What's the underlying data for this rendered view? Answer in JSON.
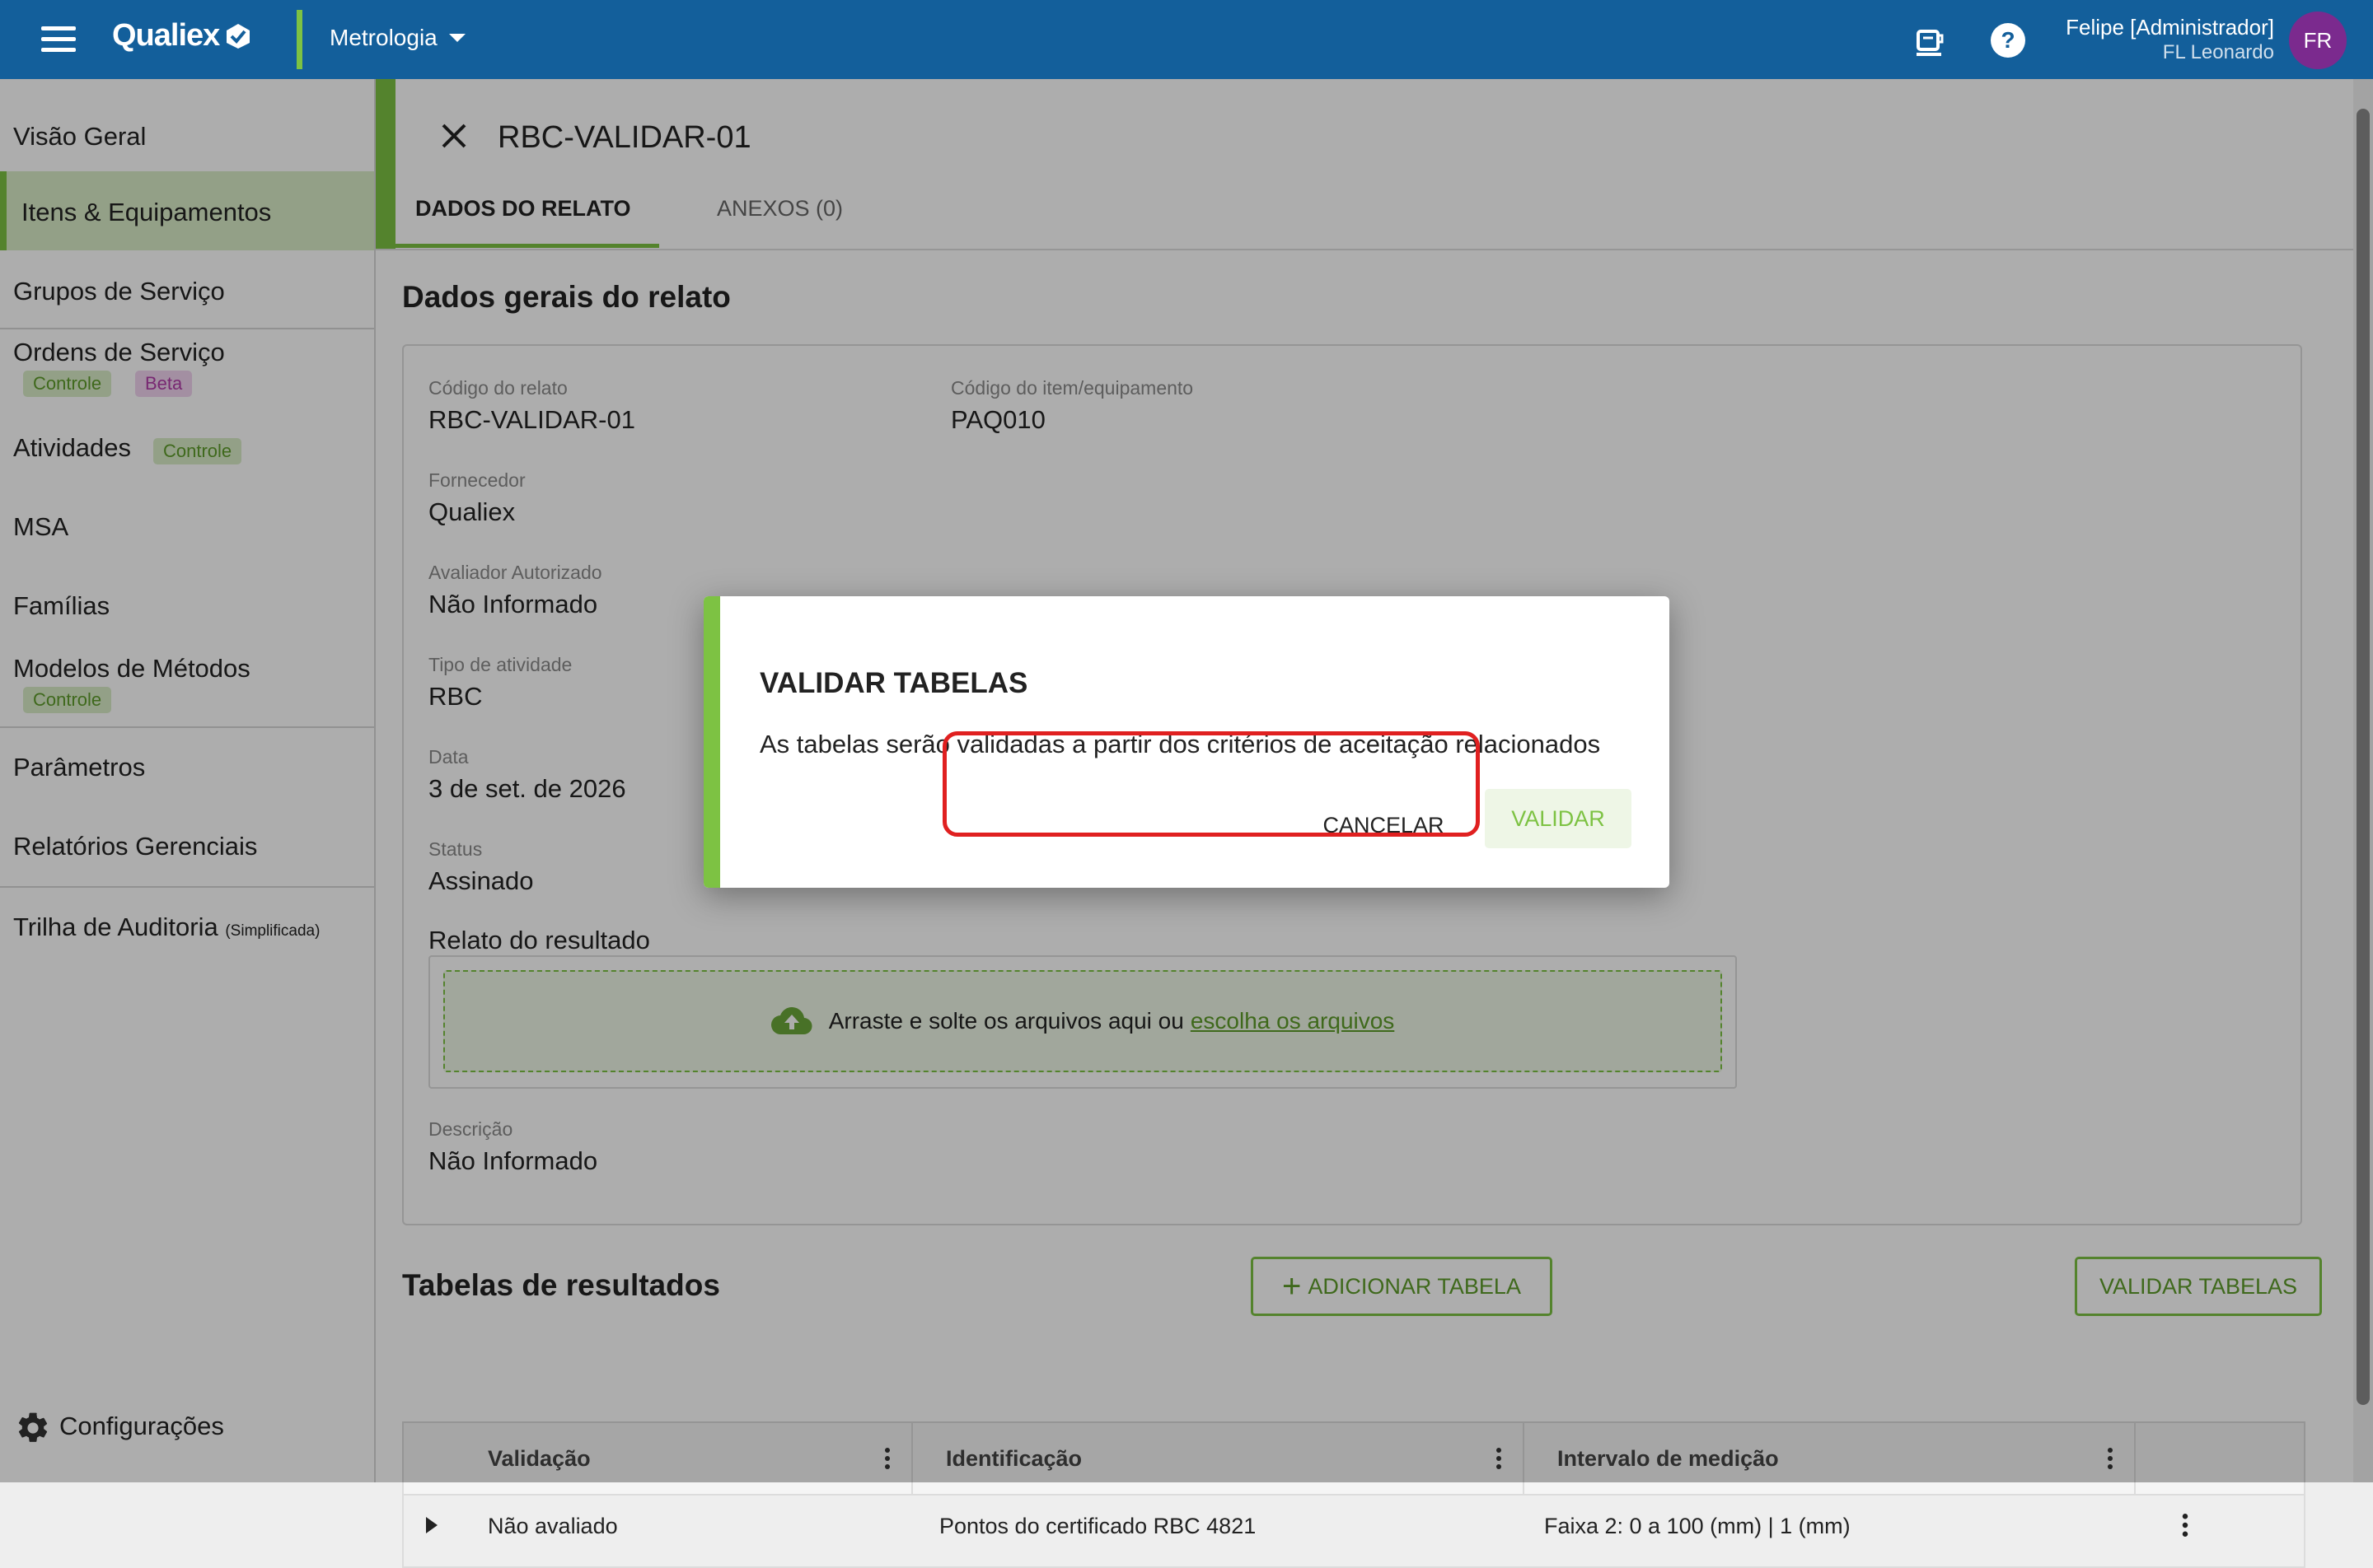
{
  "topbar": {
    "brand": "Qualiex",
    "module": "Metrologia",
    "user_name": "Felipe [Administrador]",
    "user_sub": "FL Leonardo",
    "avatar_initials": "FR",
    "icons": [
      "menu-icon",
      "coffee-cup-icon",
      "help-icon",
      "chevron-down-icon"
    ]
  },
  "sidebar": {
    "items": [
      {
        "label": "Visão Geral"
      },
      {
        "label": "Itens & Equipamentos",
        "active": true
      },
      {
        "label": "Grupos de Serviço"
      },
      {
        "label": "Ordens de Serviço",
        "badges": [
          "Controle",
          "Beta"
        ]
      },
      {
        "label": "Atividades",
        "badges": [
          "Controle"
        ]
      },
      {
        "label": "MSA"
      },
      {
        "label": "Famílias"
      },
      {
        "label": "Modelos de Métodos",
        "badges": [
          "Controle"
        ]
      },
      {
        "label": "Parâmetros"
      },
      {
        "label": "Relatórios Gerenciais"
      },
      {
        "label": "Trilha de Auditoria",
        "suffix": "(Simplificada)"
      }
    ],
    "settings_label": "Configurações"
  },
  "page": {
    "title": "RBC-VALIDAR-01",
    "tabs": [
      {
        "label": "DADOS DO RELATO",
        "active": true
      },
      {
        "label": "ANEXOS (0)",
        "active": false
      }
    ]
  },
  "general": {
    "section_title": "Dados gerais do relato",
    "fields": {
      "codigo_relato": {
        "label": "Código do relato",
        "value": "RBC-VALIDAR-01"
      },
      "codigo_item": {
        "label": "Código do item/equipamento",
        "value": "PAQ010"
      },
      "fornecedor": {
        "label": "Fornecedor",
        "value": "Qualiex"
      },
      "avaliador": {
        "label": "Avaliador Autorizado",
        "value": "Não Informado"
      },
      "tipo": {
        "label": "Tipo de atividade",
        "value": "RBC"
      },
      "data": {
        "label": "Data",
        "value": "3 de set. de 2026"
      },
      "status": {
        "label": "Status",
        "value": "Assinado"
      },
      "descricao": {
        "label": "Descrição",
        "value": "Não Informado"
      }
    },
    "relato_label": "Relato do resultado",
    "dropzone_text": "Arraste e solte os arquivos aqui ou",
    "dropzone_link": "escolha os arquivos"
  },
  "results": {
    "section_title": "Tabelas de resultados",
    "add_button": "ADICIONAR TABELA",
    "validate_button": "VALIDAR TABELAS",
    "columns": [
      "Validação",
      "Identificação",
      "Intervalo de medição"
    ],
    "rows": [
      {
        "validacao": "Não avaliado",
        "identificacao": "Pontos do certificado RBC 4821",
        "intervalo": "Faixa 2: 0 a 100 (mm) | 1 (mm)"
      }
    ]
  },
  "dialog": {
    "title": "VALIDAR TABELAS",
    "message": "As tabelas serão validadas a partir dos critérios de aceitação relacionados",
    "cancel": "CANCELAR",
    "confirm": "VALIDAR"
  },
  "colors": {
    "topbar": "#135f9b",
    "accent": "#7dc243",
    "avatar": "#7b2a8e",
    "highlight": "#e02020"
  }
}
